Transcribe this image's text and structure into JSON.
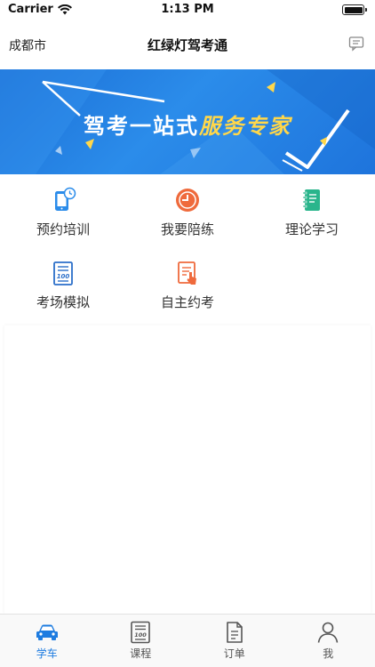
{
  "status_bar": {
    "carrier": "Carrier",
    "time": "1:13 PM"
  },
  "nav": {
    "city": "成都市",
    "title": "红绿灯驾考通",
    "message_icon": "message-icon"
  },
  "banner": {
    "text_part1": "驾考一站式",
    "text_part2": "服务专家"
  },
  "menu": {
    "items": [
      {
        "label": "预约培训",
        "icon": "phone-booking-icon"
      },
      {
        "label": "我要陪练",
        "icon": "clock-icon"
      },
      {
        "label": "理论学习",
        "icon": "notebook-icon"
      },
      {
        "label": "考场模拟",
        "icon": "exam-paper-icon"
      },
      {
        "label": "自主约考",
        "icon": "hand-form-icon"
      }
    ]
  },
  "tabs": [
    {
      "label": "学车",
      "icon": "car-icon",
      "active": true
    },
    {
      "label": "课程",
      "icon": "course-icon",
      "active": false
    },
    {
      "label": "订单",
      "icon": "order-icon",
      "active": false
    },
    {
      "label": "我",
      "icon": "user-icon",
      "active": false
    }
  ],
  "colors": {
    "accent_blue": "#1e7ce0",
    "banner_blue": "#2b8cea",
    "banner_highlight": "#ffd74a",
    "icon_orange": "#ef6a3c",
    "icon_green": "#2ab58c",
    "icon_blue": "#2b8cea"
  }
}
